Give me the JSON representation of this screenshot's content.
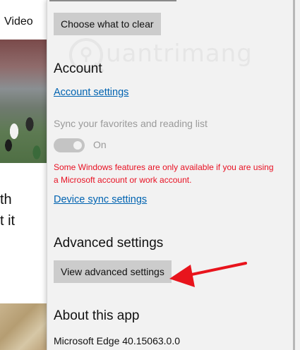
{
  "background": {
    "video_tab": "Video",
    "text_fragment_1": "th",
    "text_fragment_2": "t it"
  },
  "settings": {
    "clear_button": "Choose what to clear",
    "account": {
      "heading": "Account",
      "link": "Account settings"
    },
    "sync": {
      "label": "Sync your favorites and reading list",
      "toggle_state": "On",
      "toggle_on": true,
      "warning": "Some Windows features are only available if you are using a Microsoft account or work account.",
      "device_link": "Device sync settings"
    },
    "advanced": {
      "heading": "Advanced settings",
      "button": "View advanced settings"
    },
    "about": {
      "heading": "About this app",
      "version": "Microsoft Edge 40.15063.0.0"
    }
  },
  "watermark": {
    "text": "uantrimang"
  },
  "colors": {
    "panel_bg": "#f2f2f2",
    "button_bg": "#cccccc",
    "link": "#0063b1",
    "warning": "#e81123",
    "arrow": "#e8141c",
    "disabled": "#9a9a9a"
  }
}
